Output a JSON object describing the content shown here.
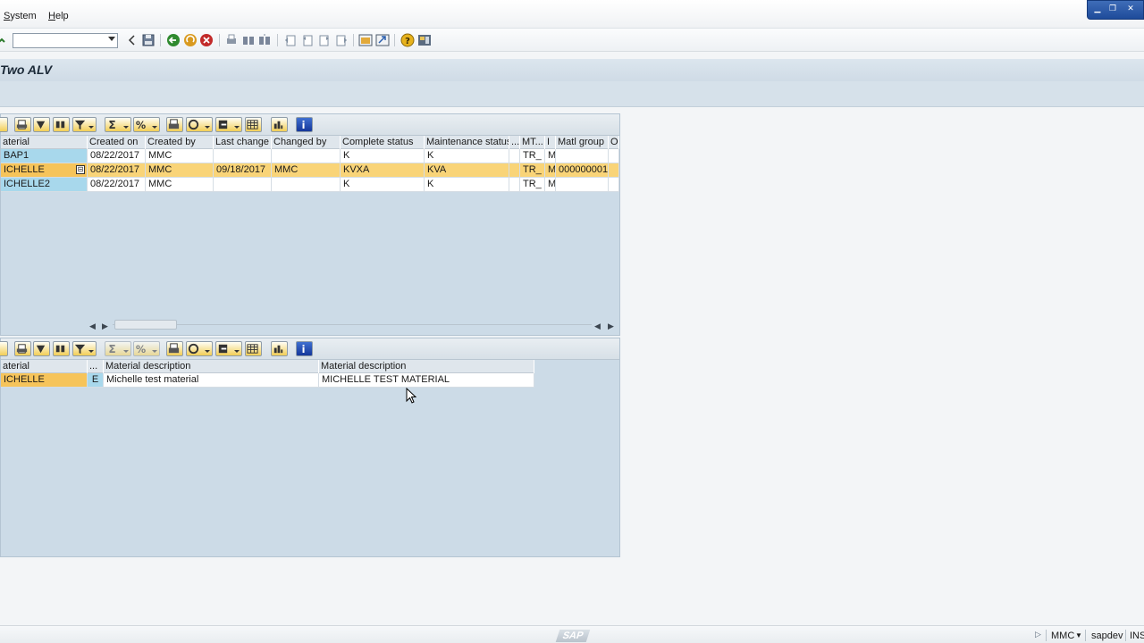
{
  "menu": {
    "items": [
      {
        "label": "System",
        "underline": "S"
      },
      {
        "label": "Help",
        "underline": "H"
      }
    ]
  },
  "toolbar": {
    "command_field_value": "",
    "icons": [
      "back-icon",
      "save-icon",
      "green-back-icon",
      "exit-icon",
      "cancel-icon",
      "print-icon",
      "find-icon",
      "find-next-icon",
      "first-page-icon",
      "previous-page-icon",
      "next-page-icon",
      "last-page-icon",
      "create-session-icon",
      "shortcut-icon",
      "help-icon",
      "customize-layout-icon"
    ]
  },
  "title": "Two ALV",
  "grid1": {
    "columns": [
      "aterial",
      "Created on",
      "Created by",
      "Last change",
      "Changed by",
      "Complete status",
      "Maintenance status",
      "...",
      "MT...",
      "I",
      "Matl group",
      "O"
    ],
    "rows": [
      {
        "cells": [
          "BAP1",
          "08/22/2017",
          "MMC",
          "",
          "",
          "K",
          "K",
          "",
          "TR_",
          "M",
          "",
          ""
        ],
        "selected": false
      },
      {
        "cells": [
          "ICHELLE",
          "08/22/2017",
          "MMC",
          "09/18/2017",
          "MMC",
          "KVXA",
          "KVA",
          "",
          "TR_",
          "M",
          "000000001",
          ""
        ],
        "selected": true
      },
      {
        "cells": [
          "ICHELLE2",
          "08/22/2017",
          "MMC",
          "",
          "",
          "K",
          "K",
          "",
          "TR_",
          "M",
          "",
          ""
        ],
        "selected": false
      }
    ]
  },
  "grid2": {
    "columns": [
      "aterial",
      "...",
      "Material description",
      "Material description"
    ],
    "rows": [
      {
        "cells": [
          "ICHELLE",
          "E",
          "Michelle test material",
          "MICHELLE TEST MATERIAL"
        ]
      }
    ]
  },
  "statusbar": {
    "logo": "SAP",
    "user": "MMC",
    "system": "sapdev",
    "mode": "INS"
  },
  "colors": {
    "selected_row": "#f9d478",
    "key_cell": "#a8d8ec",
    "grid_background": "#ccdbe7",
    "title_bar": "#d6e1ea"
  }
}
